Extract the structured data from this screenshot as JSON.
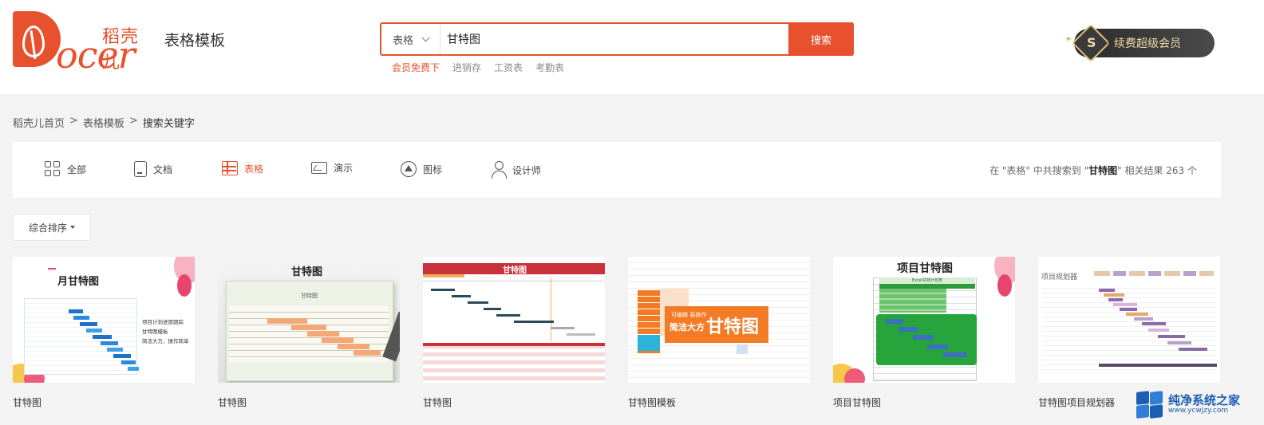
{
  "header": {
    "logo_cn": "稻壳儿",
    "logo_en": "ocer",
    "site_title": "表格模板",
    "search": {
      "category": "表格",
      "query": "甘特图",
      "button_label": "搜索"
    },
    "hot_words": [
      "会员免费下",
      "进销存",
      "工资表",
      "考勤表"
    ],
    "vip_label": "续费超级会员",
    "vip_badge": "S"
  },
  "breadcrumb": {
    "items": [
      "稻壳儿首页",
      "表格模板",
      "搜索关键字"
    ],
    "separator": ">"
  },
  "filter": {
    "tabs": [
      {
        "label": "全部",
        "icon": "grid-icon",
        "active": false
      },
      {
        "label": "文档",
        "icon": "document-icon",
        "active": false
      },
      {
        "label": "表格",
        "icon": "spreadsheet-icon",
        "active": true
      },
      {
        "label": "演示",
        "icon": "presentation-icon",
        "active": false
      },
      {
        "label": "图标",
        "icon": "logo-icon",
        "active": false
      },
      {
        "label": "设计师",
        "icon": "user-icon",
        "active": false
      }
    ],
    "result": {
      "prefix": "在 \"表格\" 中共搜索到 \"",
      "keyword": "甘特图",
      "suffix": "\" 相关结果 263 个"
    }
  },
  "sort": {
    "label": "综合排序"
  },
  "cards": [
    {
      "title": "甘特图",
      "thumb_title": "月甘特图",
      "thumb_items": [
        "项目计划进度跟踪",
        "甘特图模板",
        "简洁大方、操作简单"
      ]
    },
    {
      "title": "甘特图",
      "thumb_title": "甘特图",
      "thumb_subtitle": "甘特图"
    },
    {
      "title": "甘特图",
      "thumb_title": "甘特图"
    },
    {
      "title": "甘特图模板",
      "thumb_title": "甘特图",
      "thumb_tag": "可编辑 易操作",
      "thumb_slogan": "简洁大方"
    },
    {
      "title": "项目甘特图",
      "thumb_title": "项目甘特图",
      "thumb_subtitle": "Excel甘特计划表"
    },
    {
      "title": "甘特图项目规划器",
      "thumb_title": "项目规划器"
    }
  ],
  "watermark": {
    "line1": "纯净系统之家",
    "line2": "www.ycwjzy.com"
  },
  "colors": {
    "accent": "#e8512d",
    "background": "#f3f3f3"
  }
}
